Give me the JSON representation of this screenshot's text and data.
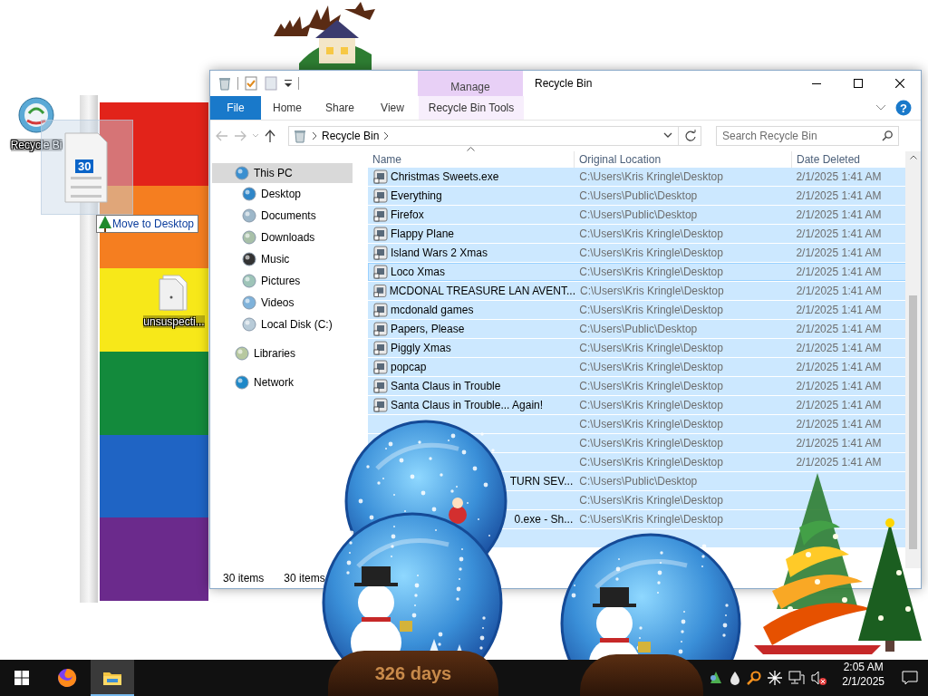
{
  "desktop": {
    "icons": [
      {
        "label": "Recycle Bi",
        "kind": "recycle-bin"
      },
      {
        "label": "unsuspecti...",
        "kind": "file"
      }
    ],
    "drag_ghost": {
      "count": "30",
      "tooltip": "Move to Desktop"
    }
  },
  "window": {
    "context_tab": "Manage",
    "title": "Recycle Bin",
    "help": "?",
    "ribbon_tabs": [
      {
        "label": "File",
        "kind": "file"
      },
      {
        "label": "Home",
        "kind": "plain"
      },
      {
        "label": "Share",
        "kind": "plain"
      },
      {
        "label": "View",
        "kind": "plain"
      },
      {
        "label": "Recycle Bin Tools",
        "kind": "contextual"
      }
    ],
    "address": "Recycle Bin",
    "search": {
      "placeholder": "Search Recycle Bin"
    },
    "nav": [
      {
        "label": "This PC",
        "selected": true,
        "children": [
          {
            "label": "Desktop",
            "selected": false
          },
          {
            "label": "Documents",
            "selected": false
          },
          {
            "label": "Downloads",
            "selected": false
          },
          {
            "label": "Music",
            "selected": false
          },
          {
            "label": "Pictures",
            "selected": false
          },
          {
            "label": "Videos",
            "selected": false
          },
          {
            "label": "Local Disk (C:)",
            "selected": false
          }
        ]
      },
      {
        "label": "Libraries",
        "selected": false
      },
      {
        "label": "Network",
        "selected": false
      }
    ],
    "columns": [
      "Name",
      "Original Location",
      "Date Deleted"
    ],
    "rows": [
      {
        "name": "Christmas Sweets.exe",
        "location": "C:\\Users\\Kris Kringle\\Desktop",
        "date": "2/1/2025 1:41 AM",
        "selected": true,
        "focused": false
      },
      {
        "name": "Everything",
        "location": "C:\\Users\\Public\\Desktop",
        "date": "2/1/2025 1:41 AM",
        "selected": true,
        "focused": false
      },
      {
        "name": "Firefox",
        "location": "C:\\Users\\Public\\Desktop",
        "date": "2/1/2025 1:41 AM",
        "selected": true,
        "focused": false
      },
      {
        "name": "Flappy Plane",
        "location": "C:\\Users\\Kris Kringle\\Desktop",
        "date": "2/1/2025 1:41 AM",
        "selected": true,
        "focused": false
      },
      {
        "name": "Island Wars 2 Xmas",
        "location": "C:\\Users\\Kris Kringle\\Desktop",
        "date": "2/1/2025 1:41 AM",
        "selected": true,
        "focused": false
      },
      {
        "name": "Loco Xmas",
        "location": "C:\\Users\\Kris Kringle\\Desktop",
        "date": "2/1/2025 1:41 AM",
        "selected": true,
        "focused": true
      },
      {
        "name": "MCDONAL TREASURE LAN AVENT...",
        "location": "C:\\Users\\Kris Kringle\\Desktop",
        "date": "2/1/2025 1:41 AM",
        "selected": true,
        "focused": false
      },
      {
        "name": "mcdonald games",
        "location": "C:\\Users\\Kris Kringle\\Desktop",
        "date": "2/1/2025 1:41 AM",
        "selected": true,
        "focused": false
      },
      {
        "name": "Papers, Please",
        "location": "C:\\Users\\Public\\Desktop",
        "date": "2/1/2025 1:41 AM",
        "selected": true,
        "focused": false
      },
      {
        "name": "Piggly Xmas",
        "location": "C:\\Users\\Kris Kringle\\Desktop",
        "date": "2/1/2025 1:41 AM",
        "selected": true,
        "focused": false
      },
      {
        "name": "popcap",
        "location": "C:\\Users\\Kris Kringle\\Desktop",
        "date": "2/1/2025 1:41 AM",
        "selected": true,
        "focused": false
      },
      {
        "name": "Santa Claus in Trouble",
        "location": "C:\\Users\\Kris Kringle\\Desktop",
        "date": "2/1/2025 1:41 AM",
        "selected": true,
        "focused": false
      },
      {
        "name": "Santa Claus in Trouble... Again!",
        "location": "C:\\Users\\Kris Kringle\\Desktop",
        "date": "2/1/2025 1:41 AM",
        "selected": true,
        "focused": false
      },
      {
        "location": "C:\\Users\\Kris Kringle\\Desktop",
        "date": "2/1/2025 1:41 AM",
        "selected": true,
        "focused": false
      },
      {
        "location": "C:\\Users\\Kris Kringle\\Desktop",
        "date": "2/1/2025 1:41 AM",
        "selected": true,
        "focused": false
      },
      {
        "location": "C:\\Users\\Kris Kringle\\Desktop",
        "date": "2/1/2025 1:41 AM",
        "selected": true,
        "focused": false
      },
      {
        "name": "TURN SEV...",
        "kind": "tail",
        "location": "C:\\Users\\Public\\Desktop",
        "selected": true,
        "focused": false
      },
      {
        "location": "C:\\Users\\Kris Kringle\\Desktop",
        "selected": true,
        "focused": false
      },
      {
        "name": "0.exe - Sh...",
        "kind": "tail",
        "location": "C:\\Users\\Kris Kringle\\Desktop",
        "selected": true,
        "focused": false
      },
      {
        "selected": true,
        "focused": false
      }
    ],
    "status": [
      "30 items",
      "30 items"
    ]
  },
  "taskbar": {
    "apps": [
      {
        "kind": "firefox",
        "active": false
      },
      {
        "kind": "explorer",
        "active": true
      }
    ],
    "widget_text": "326 days",
    "time": "2:05 AM",
    "date": "2/1/2025"
  }
}
